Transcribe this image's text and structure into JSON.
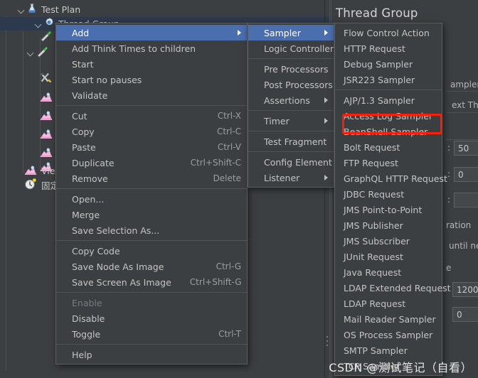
{
  "colors": {
    "app_background": "#3c3f41",
    "menu_background": "#3c3f41",
    "menu_border": "#5b5e60",
    "highlight_blue": "#4b6eaf",
    "tree_selection": "#2d3a4d",
    "annotation_red": "#fb1e0a",
    "text_primary": "#c4c4c4",
    "text_disabled": "#787b7d"
  },
  "tree": {
    "items": [
      {
        "label": "Test Plan",
        "icon": "test-plan-icon",
        "indent": 24,
        "twisty": true,
        "selected": false
      },
      {
        "label": "Thread Group",
        "icon": "thread-group-icon",
        "indent": 48,
        "twisty": true,
        "selected": true
      },
      {
        "label": "",
        "icon": "sampler-icon",
        "indent": 72,
        "twisty": false,
        "selected": false
      },
      {
        "label": "",
        "icon": "sampler-icon",
        "indent": 72,
        "twisty": true,
        "selected": false
      },
      {
        "label": "",
        "icon": "config-element-icon",
        "indent": 72,
        "twisty": false,
        "selected": false
      },
      {
        "label": "",
        "icon": "listener-icon",
        "indent": 72,
        "twisty": false,
        "selected": false
      },
      {
        "label": "",
        "icon": "listener-icon",
        "indent": 72,
        "twisty": false,
        "selected": false
      },
      {
        "label": "",
        "icon": "listener-icon",
        "indent": 72,
        "twisty": false,
        "selected": false
      },
      {
        "label": "",
        "icon": "listener-icon",
        "indent": 72,
        "twisty": false,
        "selected": false
      },
      {
        "label": "",
        "icon": "listener-icon",
        "indent": 72,
        "twisty": false,
        "selected": false
      },
      {
        "label": "View",
        "icon": "listener-icon",
        "indent": 48,
        "twisty": false,
        "selected": false
      },
      {
        "label": "固定",
        "icon": "timer-icon",
        "indent": 48,
        "twisty": false,
        "selected": false
      }
    ]
  },
  "right_panel": {
    "title": "Thread Group",
    "lines": [
      "ampler er",
      "ext Threa"
    ],
    "labels": [
      ":",
      ":",
      ":",
      "ration",
      "until nee",
      "e"
    ],
    "fields": [
      {
        "value": "50"
      },
      {
        "value": "0"
      },
      {
        "value": ""
      },
      {
        "value": "1200"
      },
      {
        "value": "0"
      }
    ]
  },
  "context_menu": {
    "name": "thread-group-context-menu",
    "items": [
      {
        "label": "Add",
        "accel": "",
        "submenu": true,
        "highlighted": true
      },
      {
        "label": "Add Think Times to children",
        "accel": "",
        "submenu": false,
        "highlighted": false
      },
      {
        "label": "Start",
        "accel": "",
        "submenu": false,
        "highlighted": false
      },
      {
        "label": "Start no pauses",
        "accel": "",
        "submenu": false,
        "highlighted": false
      },
      {
        "label": "Validate",
        "accel": "",
        "submenu": false,
        "highlighted": false
      },
      {
        "separator": true
      },
      {
        "label": "Cut",
        "accel": "Ctrl-X",
        "submenu": false,
        "highlighted": false
      },
      {
        "label": "Copy",
        "accel": "Ctrl-C",
        "submenu": false,
        "highlighted": false
      },
      {
        "label": "Paste",
        "accel": "Ctrl-V",
        "submenu": false,
        "highlighted": false
      },
      {
        "label": "Duplicate",
        "accel": "Ctrl+Shift-C",
        "submenu": false,
        "highlighted": false
      },
      {
        "label": "Remove",
        "accel": "Delete",
        "submenu": false,
        "highlighted": false
      },
      {
        "separator": true
      },
      {
        "label": "Open...",
        "accel": "",
        "submenu": false,
        "highlighted": false
      },
      {
        "label": "Merge",
        "accel": "",
        "submenu": false,
        "highlighted": false
      },
      {
        "label": "Save Selection As...",
        "accel": "",
        "submenu": false,
        "highlighted": false
      },
      {
        "separator": true
      },
      {
        "label": "Copy Code",
        "accel": "",
        "submenu": false,
        "highlighted": false
      },
      {
        "label": "Save Node As Image",
        "accel": "Ctrl-G",
        "submenu": false,
        "highlighted": false
      },
      {
        "label": "Save Screen As Image",
        "accel": "Ctrl+Shift-G",
        "submenu": false,
        "highlighted": false
      },
      {
        "separator": true
      },
      {
        "label": "Enable",
        "accel": "",
        "submenu": false,
        "highlighted": false,
        "disabled": true
      },
      {
        "label": "Disable",
        "accel": "",
        "submenu": false,
        "highlighted": false
      },
      {
        "label": "Toggle",
        "accel": "Ctrl-T",
        "submenu": false,
        "highlighted": false
      },
      {
        "separator": true
      },
      {
        "label": "Help",
        "accel": "",
        "submenu": false,
        "highlighted": false
      }
    ]
  },
  "add_submenu": {
    "name": "add-submenu",
    "items": [
      {
        "label": "Sampler",
        "submenu": true,
        "highlighted": true
      },
      {
        "label": "Logic Controller",
        "submenu": true,
        "highlighted": false
      },
      {
        "separator": true
      },
      {
        "label": "Pre Processors",
        "submenu": true,
        "highlighted": false
      },
      {
        "label": "Post Processors",
        "submenu": true,
        "highlighted": false
      },
      {
        "label": "Assertions",
        "submenu": true,
        "highlighted": false
      },
      {
        "separator": true
      },
      {
        "label": "Timer",
        "submenu": true,
        "highlighted": false
      },
      {
        "separator": true
      },
      {
        "label": "Test Fragment",
        "submenu": true,
        "highlighted": false
      },
      {
        "separator": true
      },
      {
        "label": "Config Element",
        "submenu": true,
        "highlighted": false
      },
      {
        "label": "Listener",
        "submenu": true,
        "highlighted": false
      }
    ]
  },
  "sampler_submenu": {
    "name": "sampler-submenu",
    "annotated_item": "BeanShell Sampler",
    "items": [
      {
        "label": "Flow Control Action"
      },
      {
        "label": "HTTP Request"
      },
      {
        "label": "Debug Sampler"
      },
      {
        "label": "JSR223 Sampler"
      },
      {
        "separator": true
      },
      {
        "label": "AJP/1.3 Sampler"
      },
      {
        "label": "Access Log Sampler"
      },
      {
        "label": "BeanShell Sampler",
        "annotated": true
      },
      {
        "label": "Bolt Request"
      },
      {
        "label": "FTP Request"
      },
      {
        "label": "GraphQL HTTP Request"
      },
      {
        "label": "JDBC Request"
      },
      {
        "label": "JMS Point-to-Point"
      },
      {
        "label": "JMS Publisher"
      },
      {
        "label": "JMS Subscriber"
      },
      {
        "label": "JUnit Request"
      },
      {
        "label": "Java Request"
      },
      {
        "label": "LDAP Extended Request"
      },
      {
        "label": "LDAP Request"
      },
      {
        "label": "Mail Reader Sampler"
      },
      {
        "label": "OS Process Sampler"
      },
      {
        "label": "SMTP Sampler"
      },
      {
        "label": "TCP Sampler"
      }
    ]
  },
  "watermark": {
    "text": "CSDN @测试笔记（自看）"
  }
}
